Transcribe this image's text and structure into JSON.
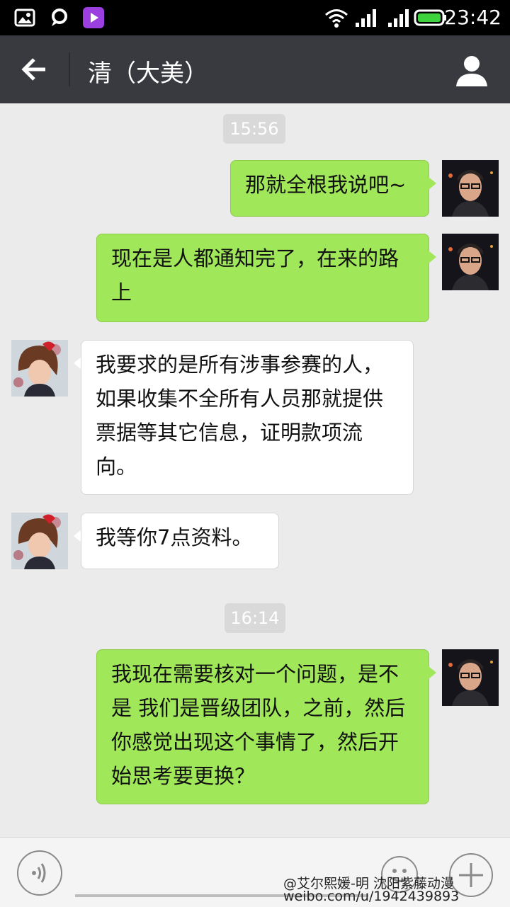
{
  "status_bar": {
    "time": "23:42",
    "icons": [
      "image-icon",
      "chat-icon",
      "video-app-icon",
      "wifi-icon",
      "signal-icon",
      "signal-icon",
      "battery-icon"
    ]
  },
  "header": {
    "back_icon": "back-arrow-icon",
    "title": "清（大美）",
    "profile_icon": "person-icon"
  },
  "messages": [
    {
      "type": "timestamp",
      "text": "15:56"
    },
    {
      "type": "sent",
      "text": "那就全根我说吧~"
    },
    {
      "type": "sent",
      "text": "现在是人都通知完了，在来的路上"
    },
    {
      "type": "received",
      "text": "我要求的是所有涉事参赛的人，如果收集不全所有人员那就提供票据等其它信息，证明款项流向。"
    },
    {
      "type": "received",
      "text": "我等你7点资料。"
    },
    {
      "type": "timestamp",
      "text": "16:14"
    },
    {
      "type": "sent",
      "text": "我现在需要核对一个问题，是不是 我们是晋级团队，之前，然后你感觉出现这个事情了，然后开始思考要更换？"
    }
  ],
  "input_bar": {
    "voice_icon": "voice-icon",
    "text_value": "",
    "emoji_icon": "emoji-icon",
    "plus_icon": "plus-icon"
  },
  "watermark": {
    "line1": "@艾尔熙媛-明 沈阳紫藤动漫",
    "line2": "weibo.com/u/1942439893"
  },
  "colors": {
    "status_bar_bg": "#000000",
    "title_bar_bg": "#393a3f",
    "chat_bg": "#ebebeb",
    "sent_bubble": "#a0e75a",
    "received_bubble": "#ffffff",
    "timestamp_bg": "#d9d9d9"
  }
}
